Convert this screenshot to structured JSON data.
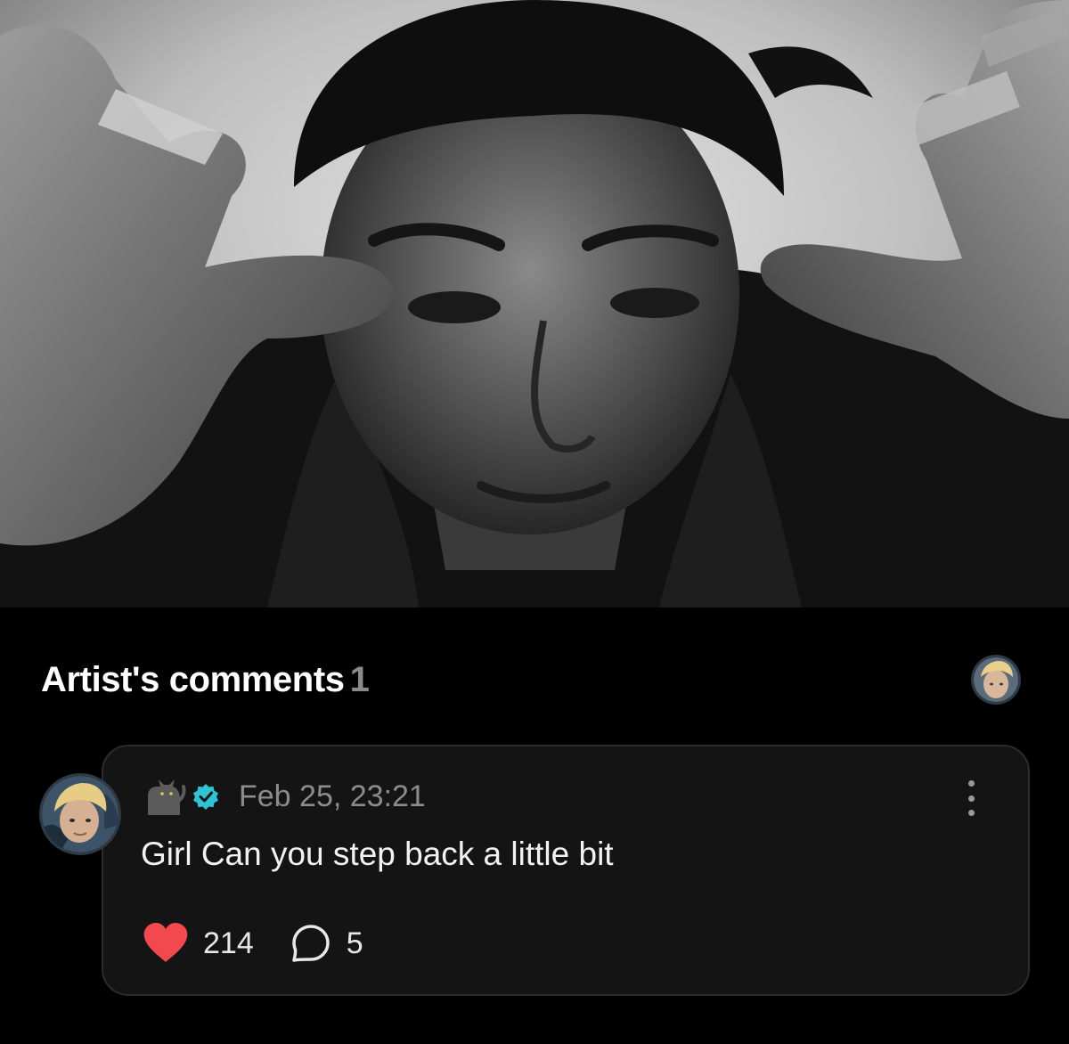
{
  "photo": {
    "icon": "artist-photo",
    "description_tone": "black-and-white"
  },
  "section": {
    "title": "Artist's comments",
    "count": "1"
  },
  "comment": {
    "author_icon": "cat-emoji-icon",
    "verified_icon": "verified-badge-icon",
    "timestamp": "Feb 25, 23:21",
    "text": "Girl Can you step back a little bit",
    "likes": "214",
    "replies": "5",
    "like_color": "#f2484e",
    "verified_color": "#2fc4d3"
  }
}
